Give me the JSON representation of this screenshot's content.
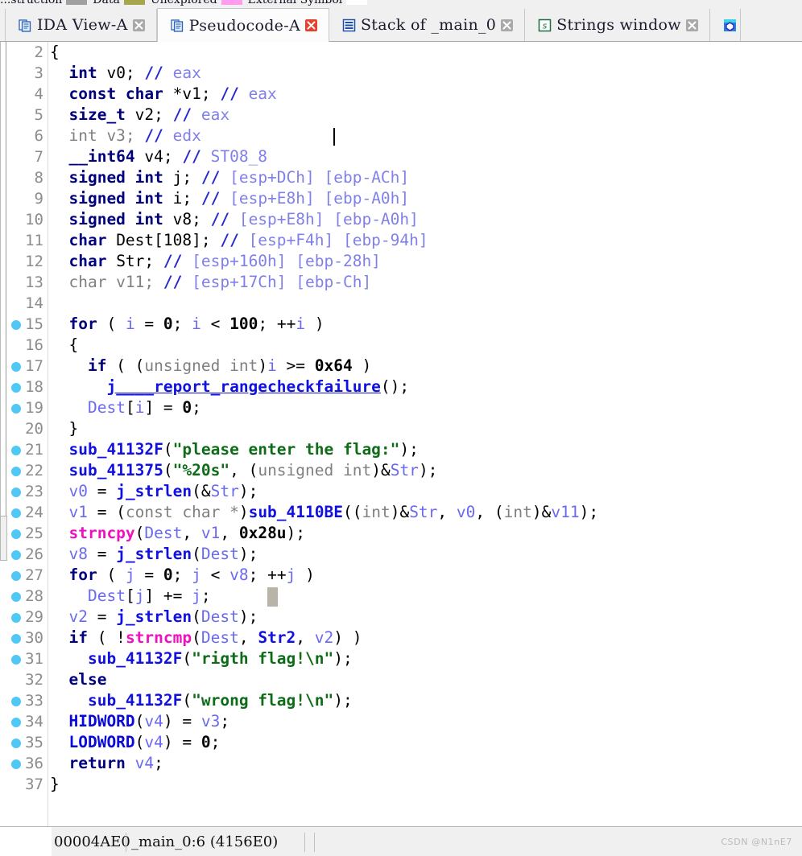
{
  "navigator_legend": [
    {
      "label": "...struction",
      "color": "#a0a0a0"
    },
    {
      "label": "Data",
      "color": "#a8a64a"
    },
    {
      "label": "Unexplored",
      "color": "#ff9cf0"
    },
    {
      "label": "External Symbol",
      "color": "#ffffff"
    }
  ],
  "tabs": [
    {
      "label": "IDA View-A",
      "icon": "pseudocode-doc-icon",
      "active": false,
      "close_icon": "close-icon",
      "close_red": false
    },
    {
      "label": "Pseudocode-A",
      "icon": "pseudocode-doc-icon",
      "active": true,
      "close_icon": "close-icon",
      "close_red": true
    },
    {
      "label": "Stack of _main_0",
      "icon": "stack-window-icon",
      "active": false,
      "close_icon": "close-icon",
      "close_red": false
    },
    {
      "label": "Strings window",
      "icon": "strings-window-icon",
      "active": false,
      "close_icon": "close-icon",
      "close_red": false
    },
    {
      "label": "",
      "icon": "hex-view-icon",
      "active": false,
      "close_icon": "",
      "close_red": false
    }
  ],
  "colors": {
    "keyword": "#00007f",
    "variable": "#6a6af0",
    "function": "#1010e0",
    "library_function": "#f010c0",
    "string": "#0e6b17",
    "comment": "#2828d0",
    "comment_dim": "#8080e8",
    "unused": "#808080",
    "breakpoint_dot": "#4fc8f5",
    "line_number": "#8c8c8c",
    "selection": "#b8b4a8"
  },
  "code": [
    {
      "n": "2",
      "bp": false,
      "indent": 0,
      "tokens": [
        {
          "c": "t-plain",
          "t": "{"
        }
      ]
    },
    {
      "n": "3",
      "bp": false,
      "indent": 0,
      "tokens": [
        {
          "c": "t-kw",
          "t": "  int "
        },
        {
          "c": "t-plain",
          "t": "v0; "
        },
        {
          "c": "t-cmt",
          "t": "// "
        },
        {
          "c": "t-cmt2",
          "t": "eax"
        }
      ]
    },
    {
      "n": "4",
      "bp": false,
      "indent": 0,
      "tokens": [
        {
          "c": "t-kw",
          "t": "  const char "
        },
        {
          "c": "t-plain",
          "t": "*v1; "
        },
        {
          "c": "t-cmt",
          "t": "// "
        },
        {
          "c": "t-cmt2",
          "t": "eax"
        }
      ]
    },
    {
      "n": "5",
      "bp": false,
      "indent": 0,
      "tokens": [
        {
          "c": "t-kw",
          "t": "  size_t "
        },
        {
          "c": "t-plain",
          "t": "v2; "
        },
        {
          "c": "t-cmt",
          "t": "// "
        },
        {
          "c": "t-cmt2",
          "t": "eax"
        }
      ]
    },
    {
      "n": "6",
      "bp": false,
      "indent": 0,
      "caret_col": 30,
      "tokens": [
        {
          "c": "t-dim",
          "t": "  int v3; "
        },
        {
          "c": "t-cmt",
          "t": "// "
        },
        {
          "c": "t-cmt2",
          "t": "edx"
        }
      ]
    },
    {
      "n": "7",
      "bp": false,
      "indent": 0,
      "tokens": [
        {
          "c": "t-kw",
          "t": "  __int64 "
        },
        {
          "c": "t-plain",
          "t": "v4; "
        },
        {
          "c": "t-cmt",
          "t": "// "
        },
        {
          "c": "t-cmt2",
          "t": "ST08_8"
        }
      ]
    },
    {
      "n": "8",
      "bp": false,
      "indent": 0,
      "tokens": [
        {
          "c": "t-kw",
          "t": "  signed int "
        },
        {
          "c": "t-plain",
          "t": "j; "
        },
        {
          "c": "t-cmt",
          "t": "// "
        },
        {
          "c": "t-cmt2",
          "t": "[esp+DCh] [ebp-ACh]"
        }
      ]
    },
    {
      "n": "9",
      "bp": false,
      "indent": 0,
      "tokens": [
        {
          "c": "t-kw",
          "t": "  signed int "
        },
        {
          "c": "t-plain",
          "t": "i; "
        },
        {
          "c": "t-cmt",
          "t": "// "
        },
        {
          "c": "t-cmt2",
          "t": "[esp+E8h] [ebp-A0h]"
        }
      ]
    },
    {
      "n": "10",
      "bp": false,
      "indent": 0,
      "tokens": [
        {
          "c": "t-kw",
          "t": "  signed int "
        },
        {
          "c": "t-plain",
          "t": "v8; "
        },
        {
          "c": "t-cmt",
          "t": "// "
        },
        {
          "c": "t-cmt2",
          "t": "[esp+E8h] [ebp-A0h]"
        }
      ]
    },
    {
      "n": "11",
      "bp": false,
      "indent": 0,
      "tokens": [
        {
          "c": "t-kw",
          "t": "  char "
        },
        {
          "c": "t-plain",
          "t": "Dest[108]; "
        },
        {
          "c": "t-cmt",
          "t": "// "
        },
        {
          "c": "t-cmt2",
          "t": "[esp+F4h] [ebp-94h]"
        }
      ]
    },
    {
      "n": "12",
      "bp": false,
      "indent": 0,
      "tokens": [
        {
          "c": "t-kw",
          "t": "  char "
        },
        {
          "c": "t-plain",
          "t": "Str; "
        },
        {
          "c": "t-cmt",
          "t": "// "
        },
        {
          "c": "t-cmt2",
          "t": "[esp+160h] [ebp-28h]"
        }
      ]
    },
    {
      "n": "13",
      "bp": false,
      "indent": 0,
      "tokens": [
        {
          "c": "t-dim",
          "t": "  char v11; "
        },
        {
          "c": "t-cmt",
          "t": "// "
        },
        {
          "c": "t-cmt2",
          "t": "[esp+17Ch] [ebp-Ch]"
        }
      ]
    },
    {
      "n": "14",
      "bp": false,
      "indent": 0,
      "tokens": [
        {
          "c": "t-plain",
          "t": ""
        }
      ]
    },
    {
      "n": "15",
      "bp": true,
      "indent": 0,
      "tokens": [
        {
          "c": "t-kw",
          "t": "  for "
        },
        {
          "c": "t-plain",
          "t": "( "
        },
        {
          "c": "t-var",
          "t": "i"
        },
        {
          "c": "t-plain",
          "t": " = "
        },
        {
          "c": "t-num",
          "t": "0"
        },
        {
          "c": "t-plain",
          "t": "; "
        },
        {
          "c": "t-var",
          "t": "i"
        },
        {
          "c": "t-plain",
          "t": " < "
        },
        {
          "c": "t-num",
          "t": "100"
        },
        {
          "c": "t-plain",
          "t": "; ++"
        },
        {
          "c": "t-var",
          "t": "i"
        },
        {
          "c": "t-plain",
          "t": " )"
        }
      ]
    },
    {
      "n": "16",
      "bp": false,
      "indent": 0,
      "tokens": [
        {
          "c": "t-plain",
          "t": "  {"
        }
      ]
    },
    {
      "n": "17",
      "bp": true,
      "indent": 0,
      "tokens": [
        {
          "c": "t-kw",
          "t": "    if "
        },
        {
          "c": "t-plain",
          "t": "( ("
        },
        {
          "c": "t-dim",
          "t": "unsigned int"
        },
        {
          "c": "t-plain",
          "t": ")"
        },
        {
          "c": "t-var",
          "t": "i"
        },
        {
          "c": "t-plain",
          "t": " >= "
        },
        {
          "c": "t-num",
          "t": "0x64"
        },
        {
          "c": "t-plain",
          "t": " )"
        }
      ]
    },
    {
      "n": "18",
      "bp": true,
      "indent": 0,
      "tokens": [
        {
          "c": "t-plain",
          "t": "      "
        },
        {
          "c": "t-fn-u",
          "t": "j____report_rangecheckfailure"
        },
        {
          "c": "t-plain",
          "t": "();"
        }
      ]
    },
    {
      "n": "19",
      "bp": true,
      "indent": 0,
      "tokens": [
        {
          "c": "t-plain",
          "t": "    "
        },
        {
          "c": "t-var",
          "t": "Dest"
        },
        {
          "c": "t-plain",
          "t": "["
        },
        {
          "c": "t-var",
          "t": "i"
        },
        {
          "c": "t-plain",
          "t": "] = "
        },
        {
          "c": "t-num",
          "t": "0"
        },
        {
          "c": "t-plain",
          "t": ";"
        }
      ]
    },
    {
      "n": "20",
      "bp": false,
      "indent": 0,
      "tokens": [
        {
          "c": "t-plain",
          "t": "  }"
        }
      ]
    },
    {
      "n": "21",
      "bp": true,
      "indent": 0,
      "tokens": [
        {
          "c": "t-plain",
          "t": "  "
        },
        {
          "c": "t-fn",
          "t": "sub_41132F"
        },
        {
          "c": "t-plain",
          "t": "("
        },
        {
          "c": "t-str",
          "t": "\"please enter the flag:\""
        },
        {
          "c": "t-plain",
          "t": ");"
        }
      ]
    },
    {
      "n": "22",
      "bp": true,
      "indent": 0,
      "tokens": [
        {
          "c": "t-plain",
          "t": "  "
        },
        {
          "c": "t-fn",
          "t": "sub_411375"
        },
        {
          "c": "t-plain",
          "t": "("
        },
        {
          "c": "t-str",
          "t": "\"%20s\""
        },
        {
          "c": "t-plain",
          "t": ", ("
        },
        {
          "c": "t-dim",
          "t": "unsigned int"
        },
        {
          "c": "t-plain",
          "t": ")&"
        },
        {
          "c": "t-var",
          "t": "Str"
        },
        {
          "c": "t-plain",
          "t": ");"
        }
      ]
    },
    {
      "n": "23",
      "bp": true,
      "indent": 0,
      "tokens": [
        {
          "c": "t-plain",
          "t": "  "
        },
        {
          "c": "t-var",
          "t": "v0"
        },
        {
          "c": "t-plain",
          "t": " = "
        },
        {
          "c": "t-fn",
          "t": "j_strlen"
        },
        {
          "c": "t-plain",
          "t": "(&"
        },
        {
          "c": "t-var",
          "t": "Str"
        },
        {
          "c": "t-plain",
          "t": ");"
        }
      ]
    },
    {
      "n": "24",
      "bp": true,
      "indent": 0,
      "tokens": [
        {
          "c": "t-plain",
          "t": "  "
        },
        {
          "c": "t-var",
          "t": "v1"
        },
        {
          "c": "t-plain",
          "t": " = ("
        },
        {
          "c": "t-dim",
          "t": "const char *"
        },
        {
          "c": "t-plain",
          "t": ")"
        },
        {
          "c": "t-fn",
          "t": "sub_4110BE"
        },
        {
          "c": "t-plain",
          "t": "(("
        },
        {
          "c": "t-dim",
          "t": "int"
        },
        {
          "c": "t-plain",
          "t": ")&"
        },
        {
          "c": "t-var",
          "t": "Str"
        },
        {
          "c": "t-plain",
          "t": ", "
        },
        {
          "c": "t-var",
          "t": "v0"
        },
        {
          "c": "t-plain",
          "t": ", ("
        },
        {
          "c": "t-dim",
          "t": "int"
        },
        {
          "c": "t-plain",
          "t": ")&"
        },
        {
          "c": "t-var",
          "t": "v11"
        },
        {
          "c": "t-plain",
          "t": ");"
        }
      ]
    },
    {
      "n": "25",
      "bp": true,
      "indent": 0,
      "tokens": [
        {
          "c": "t-plain",
          "t": "  "
        },
        {
          "c": "t-lib",
          "t": "strncpy"
        },
        {
          "c": "t-plain",
          "t": "("
        },
        {
          "c": "t-var",
          "t": "Dest"
        },
        {
          "c": "t-plain",
          "t": ", "
        },
        {
          "c": "t-var",
          "t": "v1"
        },
        {
          "c": "t-plain",
          "t": ", "
        },
        {
          "c": "t-num",
          "t": "0x28u"
        },
        {
          "c": "t-plain",
          "t": ");"
        }
      ]
    },
    {
      "n": "26",
      "bp": true,
      "indent": 0,
      "tokens": [
        {
          "c": "t-plain",
          "t": "  "
        },
        {
          "c": "t-var",
          "t": "v8"
        },
        {
          "c": "t-plain",
          "t": " = "
        },
        {
          "c": "t-fn",
          "t": "j_strlen"
        },
        {
          "c": "t-plain",
          "t": "("
        },
        {
          "c": "t-var",
          "t": "Dest"
        },
        {
          "c": "t-plain",
          "t": ");"
        }
      ]
    },
    {
      "n": "27",
      "bp": true,
      "indent": 0,
      "tokens": [
        {
          "c": "t-kw",
          "t": "  for "
        },
        {
          "c": "t-plain",
          "t": "( "
        },
        {
          "c": "t-var",
          "t": "j"
        },
        {
          "c": "t-plain",
          "t": " = "
        },
        {
          "c": "t-num",
          "t": "0"
        },
        {
          "c": "t-plain",
          "t": "; "
        },
        {
          "c": "t-var",
          "t": "j"
        },
        {
          "c": "t-plain",
          "t": " < "
        },
        {
          "c": "t-var",
          "t": "v8"
        },
        {
          "c": "t-plain",
          "t": "; ++"
        },
        {
          "c": "t-var",
          "t": "j"
        },
        {
          "c": "t-plain",
          "t": " )"
        }
      ]
    },
    {
      "n": "28",
      "bp": true,
      "indent": 0,
      "sel_col": 23,
      "tokens": [
        {
          "c": "t-plain",
          "t": "    "
        },
        {
          "c": "t-var",
          "t": "Dest"
        },
        {
          "c": "t-plain",
          "t": "["
        },
        {
          "c": "t-var",
          "t": "j"
        },
        {
          "c": "t-plain",
          "t": "] += "
        },
        {
          "c": "t-var",
          "t": "j"
        },
        {
          "c": "t-plain",
          "t": ";"
        }
      ]
    },
    {
      "n": "29",
      "bp": true,
      "indent": 0,
      "tokens": [
        {
          "c": "t-plain",
          "t": "  "
        },
        {
          "c": "t-var",
          "t": "v2"
        },
        {
          "c": "t-plain",
          "t": " = "
        },
        {
          "c": "t-fn",
          "t": "j_strlen"
        },
        {
          "c": "t-plain",
          "t": "("
        },
        {
          "c": "t-var",
          "t": "Dest"
        },
        {
          "c": "t-plain",
          "t": ");"
        }
      ]
    },
    {
      "n": "30",
      "bp": true,
      "indent": 0,
      "tokens": [
        {
          "c": "t-kw",
          "t": "  if "
        },
        {
          "c": "t-plain",
          "t": "( !"
        },
        {
          "c": "t-lib",
          "t": "strncmp"
        },
        {
          "c": "t-plain",
          "t": "("
        },
        {
          "c": "t-var",
          "t": "Dest"
        },
        {
          "c": "t-plain",
          "t": ", "
        },
        {
          "c": "t-fn",
          "t": "Str2"
        },
        {
          "c": "t-plain",
          "t": ", "
        },
        {
          "c": "t-var",
          "t": "v2"
        },
        {
          "c": "t-plain",
          "t": ") )"
        }
      ]
    },
    {
      "n": "31",
      "bp": true,
      "indent": 0,
      "tokens": [
        {
          "c": "t-plain",
          "t": "    "
        },
        {
          "c": "t-fn",
          "t": "sub_41132F"
        },
        {
          "c": "t-plain",
          "t": "("
        },
        {
          "c": "t-str",
          "t": "\"rigth flag!\\n\""
        },
        {
          "c": "t-plain",
          "t": ");"
        }
      ]
    },
    {
      "n": "32",
      "bp": false,
      "indent": 0,
      "tokens": [
        {
          "c": "t-kw",
          "t": "  else"
        }
      ]
    },
    {
      "n": "33",
      "bp": true,
      "indent": 0,
      "tokens": [
        {
          "c": "t-plain",
          "t": "    "
        },
        {
          "c": "t-fn",
          "t": "sub_41132F"
        },
        {
          "c": "t-plain",
          "t": "("
        },
        {
          "c": "t-str",
          "t": "\"wrong flag!\\n\""
        },
        {
          "c": "t-plain",
          "t": ");"
        }
      ]
    },
    {
      "n": "34",
      "bp": true,
      "indent": 0,
      "tokens": [
        {
          "c": "t-plain",
          "t": "  "
        },
        {
          "c": "t-macro",
          "t": "HIDWORD"
        },
        {
          "c": "t-plain",
          "t": "("
        },
        {
          "c": "t-var",
          "t": "v4"
        },
        {
          "c": "t-plain",
          "t": ") = "
        },
        {
          "c": "t-var",
          "t": "v3"
        },
        {
          "c": "t-plain",
          "t": ";"
        }
      ]
    },
    {
      "n": "35",
      "bp": true,
      "indent": 0,
      "tokens": [
        {
          "c": "t-plain",
          "t": "  "
        },
        {
          "c": "t-macro",
          "t": "LODWORD"
        },
        {
          "c": "t-plain",
          "t": "("
        },
        {
          "c": "t-var",
          "t": "v4"
        },
        {
          "c": "t-plain",
          "t": ") = "
        },
        {
          "c": "t-num",
          "t": "0"
        },
        {
          "c": "t-plain",
          "t": ";"
        }
      ]
    },
    {
      "n": "36",
      "bp": true,
      "indent": 0,
      "tokens": [
        {
          "c": "t-kw",
          "t": "  return "
        },
        {
          "c": "t-var",
          "t": "v4"
        },
        {
          "c": "t-plain",
          "t": ";"
        }
      ]
    },
    {
      "n": "37",
      "bp": false,
      "indent": 0,
      "tokens": [
        {
          "c": "t-plain",
          "t": "}"
        }
      ]
    }
  ],
  "statusbar": {
    "offset": "00004AE0",
    "location": "_main_0:6 (4156E0)",
    "watermark": "CSDN @N1nE7"
  }
}
